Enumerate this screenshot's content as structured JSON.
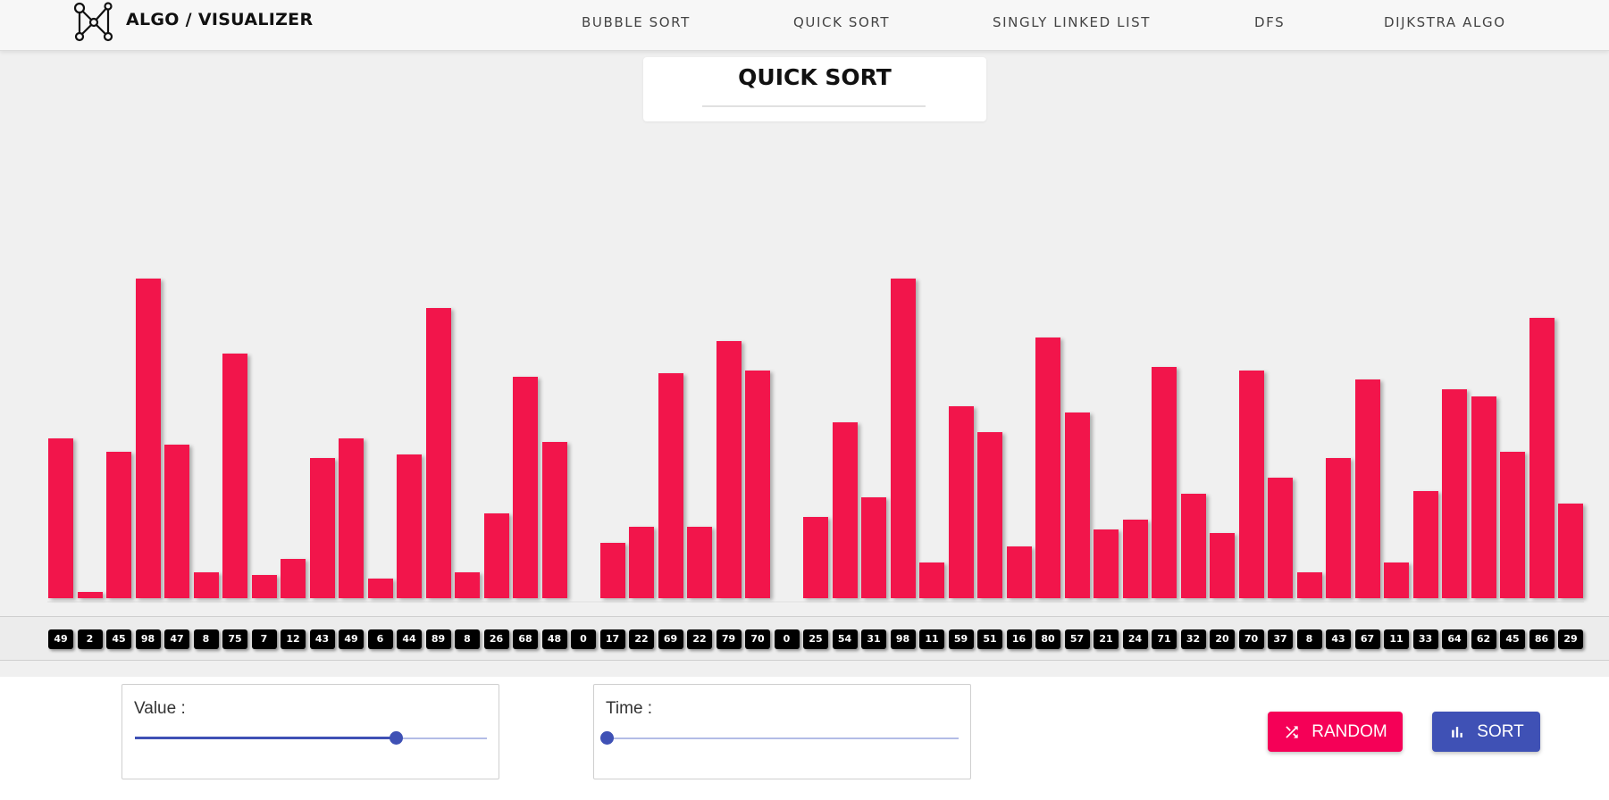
{
  "header": {
    "brand": "ALGO / VISUALIZER",
    "nav": [
      "BUBBLE SORT",
      "QUICK SORT",
      "SINGLY LINKED LIST",
      "DFS",
      "DIJKSTRA ALGO"
    ]
  },
  "title": "QUICK SORT",
  "array": {
    "values": [
      49,
      2,
      45,
      98,
      47,
      8,
      75,
      7,
      12,
      43,
      49,
      6,
      44,
      89,
      8,
      26,
      68,
      48,
      0,
      17,
      22,
      69,
      22,
      79,
      70,
      0,
      25,
      54,
      31,
      98,
      11,
      59,
      51,
      16,
      80,
      57,
      21,
      24,
      71,
      32,
      20,
      70,
      37,
      8,
      43,
      67,
      11,
      33,
      64,
      62,
      45,
      86,
      29
    ],
    "max_value": 100,
    "bar_color": "#f2154b"
  },
  "controls": {
    "value_label": "Value :",
    "value_slider_fraction": 0.74,
    "time_label": "Time :",
    "time_slider_fraction": 0.0,
    "random_label": "RANDOM",
    "random_icon": "shuffle-icon",
    "random_color": "#f50057",
    "sort_label": "SORT",
    "sort_icon": "bar-chart-icon",
    "sort_color": "#3f51b5"
  }
}
